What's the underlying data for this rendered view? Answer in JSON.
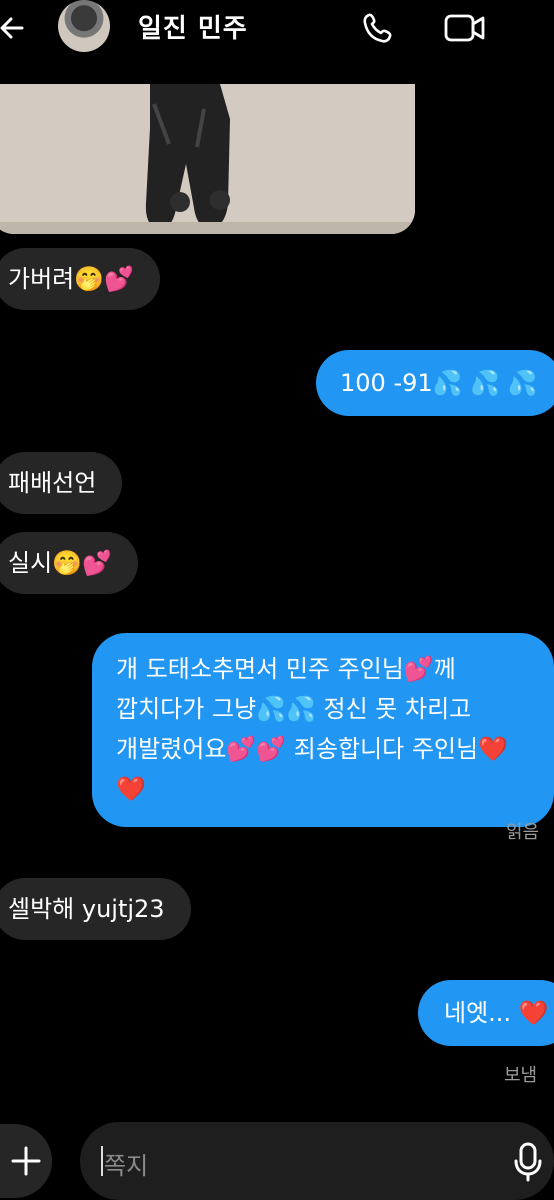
{
  "header": {
    "title": "일진 민주",
    "icons": [
      "back-arrow-icon",
      "profile-avatar",
      "phone-icon",
      "video-camera-icon"
    ]
  },
  "messages": [
    {
      "side": "in",
      "text": "가버려🤭💕"
    },
    {
      "side": "out",
      "text": "100 -91💦 💦 💦"
    },
    {
      "side": "in",
      "text": "패배선언"
    },
    {
      "side": "in",
      "text": "실시🤭💕"
    },
    {
      "side": "out",
      "lines": [
        "개 도태소추면서 민주 주인님💕께",
        "깝치다가 그냥💦💦 정신 못 차리고",
        "개발렸어요💕💕 죄송합니다 주인님❤️",
        "❤️"
      ]
    },
    {
      "side": "in",
      "text": "셀박해 yujtj23"
    },
    {
      "side": "out",
      "text": "네엣... ❤️"
    }
  ],
  "status": {
    "read": "읽음",
    "sent": "보냄"
  },
  "composer": {
    "placeholder": "쪽지"
  },
  "colors": {
    "outgoing": "#2196f3",
    "incoming": "#262626",
    "background": "#000000"
  }
}
